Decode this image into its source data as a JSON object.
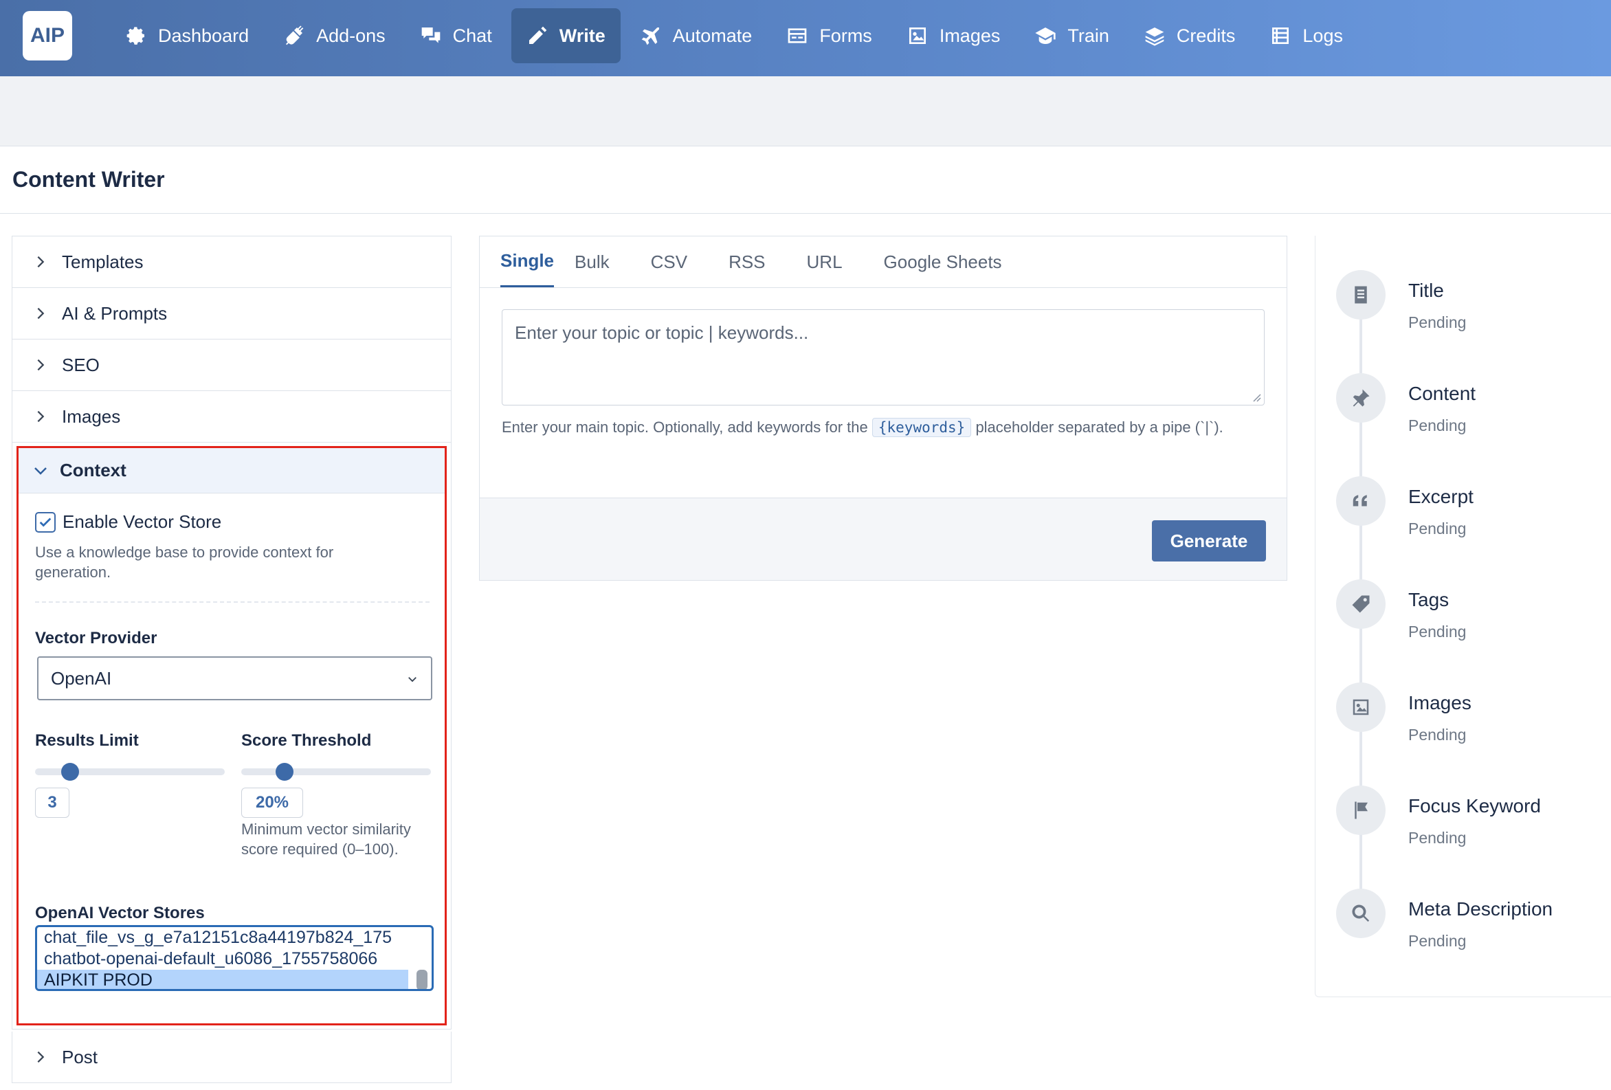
{
  "app": {
    "logo": "AIP",
    "page_title": "Content Writer"
  },
  "nav": [
    {
      "label": "Dashboard",
      "icon": "gear-icon"
    },
    {
      "label": "Add-ons",
      "icon": "plug-icon"
    },
    {
      "label": "Chat",
      "icon": "chat-icon"
    },
    {
      "label": "Write",
      "icon": "pencil-icon",
      "active": true
    },
    {
      "label": "Automate",
      "icon": "plane-icon"
    },
    {
      "label": "Forms",
      "icon": "form-icon"
    },
    {
      "label": "Images",
      "icon": "image-icon"
    },
    {
      "label": "Train",
      "icon": "graduation-icon"
    },
    {
      "label": "Credits",
      "icon": "coins-icon"
    },
    {
      "label": "Logs",
      "icon": "list-icon"
    }
  ],
  "sidebar": {
    "sections": [
      "Templates",
      "AI & Prompts",
      "SEO",
      "Images"
    ],
    "context": {
      "title": "Context",
      "enable_label": "Enable Vector Store",
      "enable_checked": true,
      "enable_help": "Use a knowledge base to provide context for generation.",
      "provider_label": "Vector Provider",
      "provider_value": "OpenAI",
      "results_label": "Results Limit",
      "results_value": "3",
      "results_fraction": 0.15,
      "threshold_label": "Score Threshold",
      "threshold_value": "20%",
      "threshold_fraction": 0.2,
      "threshold_help": "Minimum vector similarity score required (0–100).",
      "stores_label": "OpenAI Vector Stores",
      "stores": [
        "chat_file_vs_g_e7a12151c8a44197b824_175",
        "chatbot-openai-default_u6086_1755758066",
        "AIPKIT PROD"
      ],
      "stores_selected": "AIPKIT PROD"
    },
    "post": "Post"
  },
  "center": {
    "tabs": [
      "Single",
      "Bulk",
      "CSV",
      "RSS",
      "URL",
      "Google Sheets"
    ],
    "topic_placeholder": "Enter your topic or topic | keywords...",
    "hint_before": "Enter your main topic. Optionally, add keywords for the",
    "hint_code": "{keywords}",
    "hint_after": "placeholder separated by a pipe (`|`).",
    "generate_label": "Generate"
  },
  "progress": [
    {
      "title": "Title",
      "status": "Pending",
      "icon": "document-icon"
    },
    {
      "title": "Content",
      "status": "Pending",
      "icon": "pin-icon"
    },
    {
      "title": "Excerpt",
      "status": "Pending",
      "icon": "quote-icon"
    },
    {
      "title": "Tags",
      "status": "Pending",
      "icon": "tag-icon"
    },
    {
      "title": "Images",
      "status": "Pending",
      "icon": "image-icon"
    },
    {
      "title": "Focus Keyword",
      "status": "Pending",
      "icon": "flag-icon"
    },
    {
      "title": "Meta Description",
      "status": "Pending",
      "icon": "search-icon"
    }
  ]
}
